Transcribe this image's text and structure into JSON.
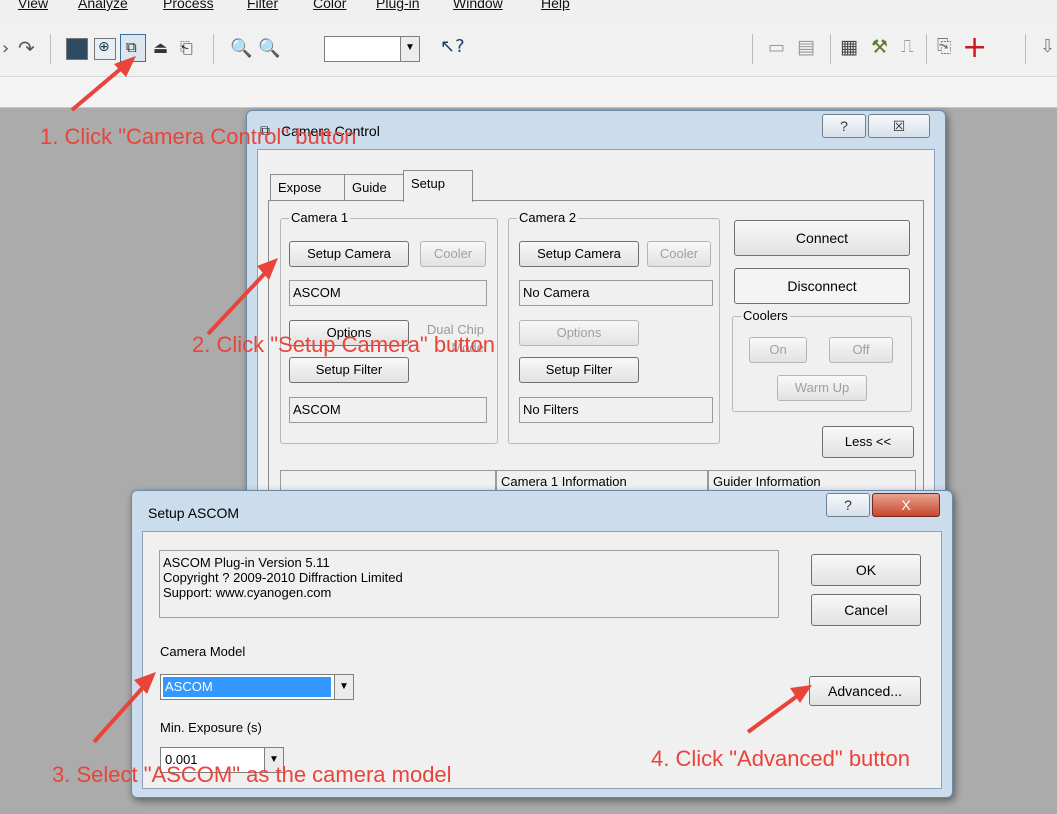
{
  "menu": [
    "View",
    "Analyze",
    "Process",
    "Filter",
    "Color",
    "Plug-in",
    "Window",
    "Help"
  ],
  "toolbar": {
    "zoom_value": ""
  },
  "camera_control": {
    "title": "Camera Control",
    "help_glyph": "?",
    "close_glyph": "☒",
    "tabs": [
      "Expose",
      "Guide",
      "Setup"
    ],
    "camera1": {
      "label": "Camera 1",
      "setup_button": "Setup Camera",
      "cooler_button": "Cooler",
      "model_field": "ASCOM",
      "options_button": "Options",
      "dual_chip": "Dual Chip Mode",
      "setup_filter_button": "Setup Filter",
      "filter_field": "ASCOM"
    },
    "camera2": {
      "label": "Camera 2",
      "setup_button": "Setup Camera",
      "cooler_button": "Cooler",
      "model_field": "No Camera",
      "options_button": "Options",
      "setup_filter_button": "Setup Filter",
      "filter_field": "No Filters"
    },
    "connect_button": "Connect",
    "disconnect_button": "Disconnect",
    "coolers": {
      "label": "Coolers",
      "on_button": "On",
      "off_button": "Off",
      "warmup_button": "Warm Up"
    },
    "less_button": "Less <<",
    "info_headers": [
      "Camera 1 Information",
      "Guider Information"
    ]
  },
  "setup_ascom": {
    "title": "Setup ASCOM",
    "help_glyph": "?",
    "close_glyph": "X",
    "info_lines": [
      "ASCOM Plug-in Version 5.11",
      "Copyright ? 2009-2010 Diffraction Limited",
      "Support: www.cyanogen.com"
    ],
    "ok_button": "OK",
    "cancel_button": "Cancel",
    "camera_model_label": "Camera Model",
    "camera_model_value": "ASCOM",
    "advanced_button": "Advanced...",
    "min_exposure_label": "Min. Exposure (s)",
    "min_exposure_value": "0.001"
  },
  "annotations": {
    "step1": "1. Click \"Camera Control\" button",
    "step2": "2. Click \"Setup Camera\" button",
    "step3": "3. Select \"ASCOM\" as the camera model",
    "step4": "4. Click \"Advanced\" button"
  },
  "colors": {
    "annotation": "#e8443a",
    "selection": "#3399ff",
    "window_frame": "#cbdcec"
  }
}
